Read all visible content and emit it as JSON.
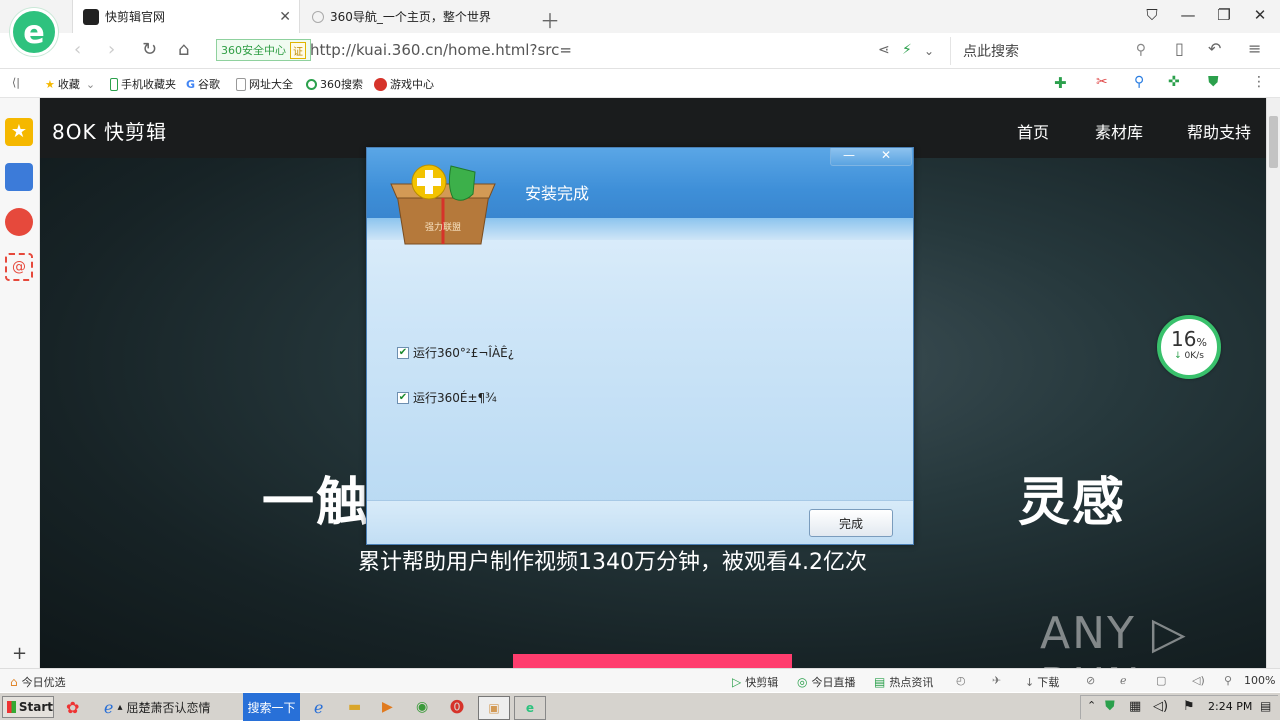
{
  "browser": {
    "tabs": [
      {
        "label": "快剪辑官网",
        "active": true
      },
      {
        "label": "360导航_一个主页，整个世界",
        "active": false
      }
    ],
    "security_badge": "360安全中心",
    "security_badge_mark": "证",
    "url": "http://kuai.360.cn/home.html?src=",
    "search_placeholder": "点此搜索",
    "logo_letter": "e"
  },
  "bookmarks": [
    {
      "label": "收藏",
      "icon": "star-icon"
    },
    {
      "label": "手机收藏夹",
      "icon": "phone-icon"
    },
    {
      "label": "谷歌",
      "icon": "google-icon"
    },
    {
      "label": "网址大全",
      "icon": "page-icon"
    },
    {
      "label": "360搜索",
      "icon": "360-search-icon"
    },
    {
      "label": "游戏中心",
      "icon": "game-icon"
    }
  ],
  "site": {
    "logo": "8OK 快剪辑",
    "nav": [
      "首页",
      "素材库",
      "帮助支持"
    ],
    "hero_title": "一触　　　　　　　　　　　　灵感",
    "hero_subtitle": "累计帮助用户制作视频1340万分钟，被观看4.2亿次",
    "watermark": "ANY ▷ RUN"
  },
  "speed_widget": {
    "percent": "16",
    "unit": "%",
    "rate": "0K/s"
  },
  "dialog": {
    "title": "安装完成",
    "box_label": "强力联盟",
    "options": [
      {
        "label": "运行360°²£¬ÎÀÊ¿",
        "checked": true
      },
      {
        "label": "运行360É±¶¾",
        "checked": true
      }
    ],
    "finish_button": "完成",
    "min_symbol": "—",
    "close_symbol": "✕"
  },
  "statusbar": {
    "left": "今日优选",
    "items": [
      "快剪辑",
      "今日直播",
      "热点资讯"
    ],
    "download": "下载",
    "zoom": "100%"
  },
  "taskbar": {
    "start": "Start",
    "task_item": "屈楚萧否认恋情",
    "search_button": "搜索一下",
    "clock": "2:24 PM"
  },
  "colors": {
    "accent_green": "#2ec27e",
    "cta_pink": "#ff3d6e",
    "dialog_blue": "#3e8fd8"
  }
}
